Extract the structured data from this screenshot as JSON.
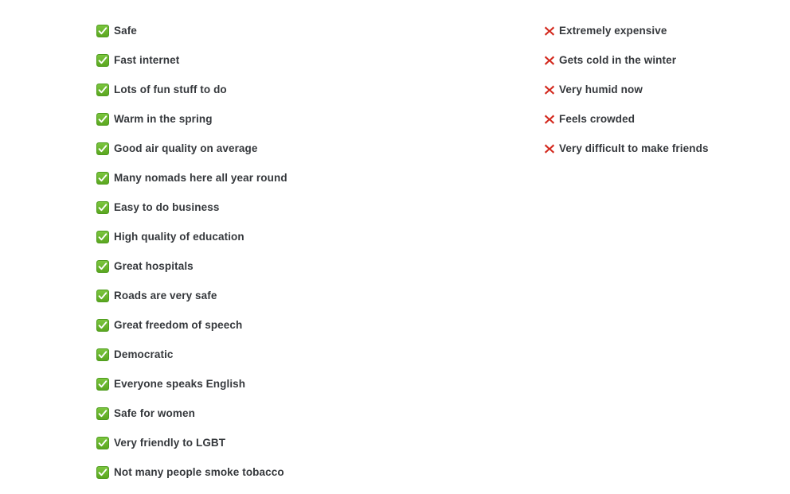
{
  "theme": {
    "background": "#ffffff",
    "text_color": "#35383c",
    "pro_icon_color": "#6ab82e",
    "pro_icon_border": "#4f9c1e",
    "pro_check_color": "#ffffff",
    "con_icon_color": "#d3291e"
  },
  "pros": {
    "icon_name": "white-heavy-check-mark-icon",
    "items": [
      {
        "label": "Safe"
      },
      {
        "label": "Fast internet"
      },
      {
        "label": "Lots of fun stuff to do"
      },
      {
        "label": "Warm in the spring"
      },
      {
        "label": "Good air quality on average"
      },
      {
        "label": "Many nomads here all year round"
      },
      {
        "label": "Easy to do business"
      },
      {
        "label": "High quality of education"
      },
      {
        "label": "Great hospitals"
      },
      {
        "label": "Roads are very safe"
      },
      {
        "label": "Great freedom of speech"
      },
      {
        "label": "Democratic"
      },
      {
        "label": "Everyone speaks English"
      },
      {
        "label": "Safe for women"
      },
      {
        "label": "Very friendly to LGBT"
      },
      {
        "label": "Not many people smoke tobacco"
      }
    ]
  },
  "cons": {
    "icon_name": "cross-mark-icon",
    "items": [
      {
        "label": "Extremely expensive"
      },
      {
        "label": "Gets cold in the winter"
      },
      {
        "label": "Very humid now"
      },
      {
        "label": "Feels crowded"
      },
      {
        "label": "Very difficult to make friends"
      }
    ]
  }
}
